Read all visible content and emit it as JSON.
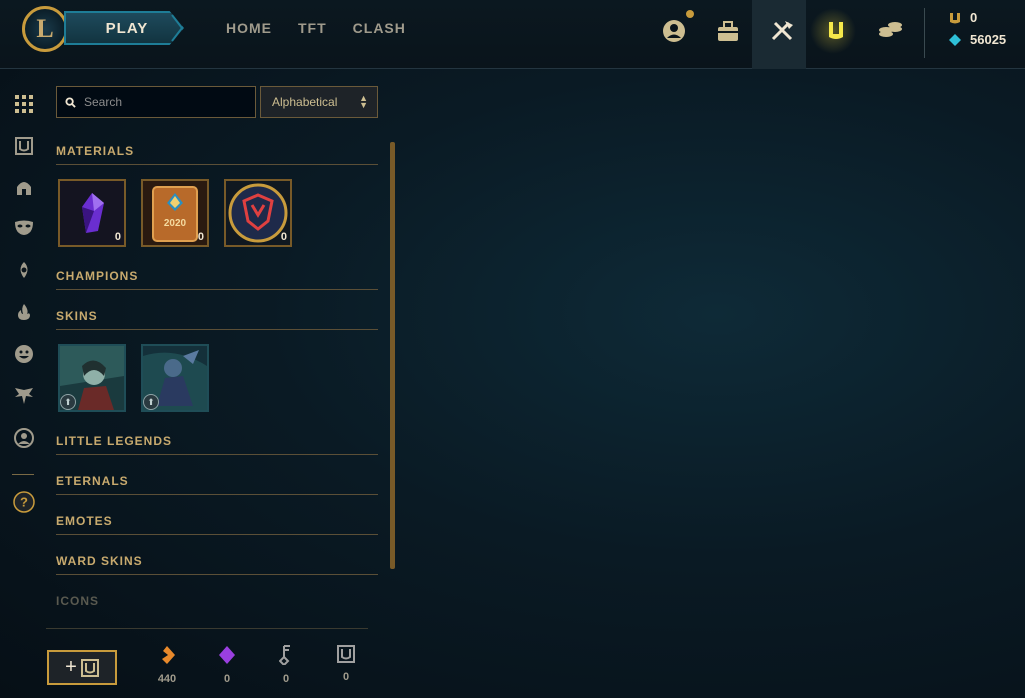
{
  "header": {
    "logo_letter": "L",
    "play_label": "PLAY",
    "nav": [
      "HOME",
      "TFT",
      "CLASH"
    ],
    "icons": [
      "profile-icon",
      "collection-icon",
      "loot-icon",
      "blue-essence-icon",
      "store-icon"
    ],
    "currency_rp": "0",
    "currency_be": "56025"
  },
  "sidebar": {
    "icons": [
      "grid-icon",
      "chest-icon",
      "helmet-icon",
      "mask-icon",
      "flame-icon",
      "emote-icon",
      "little-legend-icon",
      "avatar-icon",
      "help-icon"
    ]
  },
  "toolbar": {
    "search_placeholder": "Search",
    "sort_value": "Alphabetical"
  },
  "sections": {
    "materials": "MATERIALS",
    "champions": "CHAMPIONS",
    "skins": "SKINS",
    "little_legends": "LITTLE LEGENDS",
    "eternals": "ETERNALS",
    "emotes": "EMOTES",
    "ward_skins": "WARD SKINS",
    "icons": "ICONS"
  },
  "materials": [
    {
      "name": "key-fragment",
      "count": "0",
      "label": ""
    },
    {
      "name": "event-pass",
      "count": "0",
      "label": "2020"
    },
    {
      "name": "worlds-token",
      "count": "0",
      "label": ""
    }
  ],
  "footer": {
    "craft_plus": "+",
    "wallet": [
      {
        "icon": "orange-essence-icon",
        "value": "440",
        "color": "#e8892b"
      },
      {
        "icon": "mythic-essence-icon",
        "value": "0",
        "color": "#9a3fe0"
      },
      {
        "icon": "key-icon",
        "value": "0",
        "color": "#a0a0a0"
      },
      {
        "icon": "chest-icon",
        "value": "0",
        "color": "#a0a0a0"
      }
    ]
  },
  "colors": {
    "gold": "#c89b3c",
    "accent_teal": "#1e7d97"
  }
}
